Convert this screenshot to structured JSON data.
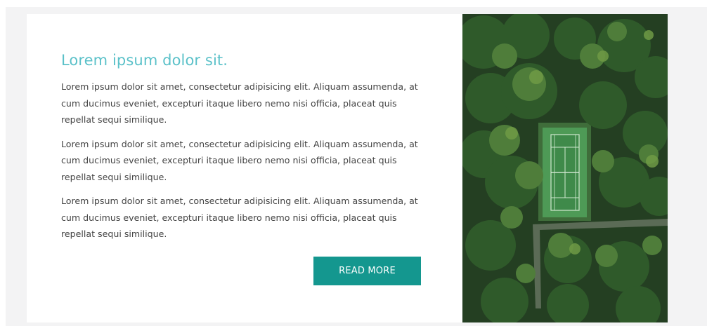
{
  "section": {
    "title": "Lorem ipsum dolor sit.",
    "paragraphs": [
      "Lorem ipsum dolor sit amet, consectetur adipisicing elit. Aliquam assumenda, at cum ducimus eveniet, excepturi itaque libero nemo nisi officia, placeat quis repellat sequi similique.",
      "Lorem ipsum dolor sit amet, consectetur adipisicing elit. Aliquam assumenda, at cum ducimus eveniet, excepturi itaque libero nemo nisi officia, placeat quis repellat sequi similique.",
      "Lorem ipsum dolor sit amet, consectetur adipisicing elit. Aliquam assumenda, at cum ducimus eveniet, excepturi itaque libero nemo nisi officia, placeat quis repellat sequi similique."
    ],
    "button_label": "READ MORE"
  },
  "colors": {
    "title": "#5bc1c9",
    "button": "#14978f",
    "body_text": "#444444",
    "page_background": "#f3f3f4"
  },
  "image": {
    "subject": "aerial-forest-tennis-court"
  }
}
